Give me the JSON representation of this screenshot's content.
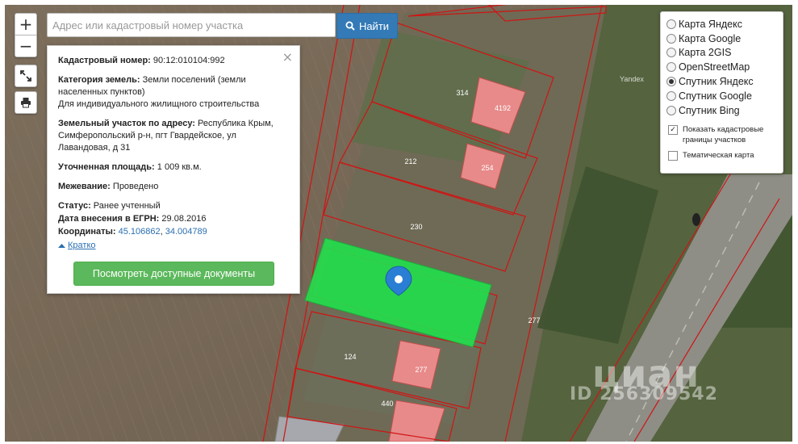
{
  "search": {
    "placeholder": "Адрес или кадастровый номер участка",
    "button_label": "Найти"
  },
  "zoom": {
    "in_label": "+",
    "out_label": "−"
  },
  "popup": {
    "cadastral_label": "Кадастровый номер:",
    "cadastral_value": "90:12:010104:992",
    "category_label": "Категория земель:",
    "category_value": "Земли поселений (земли населенных пунктов)",
    "category_use": "Для индивидуального жилищного строительства",
    "address_label": "Земельный участок по адресу:",
    "address_value": "Республика Крым, Симферопольский р-н, пгт Гвардейское, ул Лавандовая, д 31",
    "area_label": "Уточненная площадь:",
    "area_value": "1 009 кв.м.",
    "survey_label": "Межевание:",
    "survey_value": "Проведено",
    "status_label": "Статус:",
    "status_value": "Ранее учтенный",
    "egrn_label": "Дата внесения в ЕГРН:",
    "egrn_value": "29.08.2016",
    "coords_label": "Координаты:",
    "coords_lat": "45.106862",
    "coords_sep": ", ",
    "coords_lon": "34.004789",
    "brief_label": "Кратко",
    "docs_button": "Посмотреть доступные документы",
    "close_label": "×"
  },
  "layers": {
    "options": [
      "Карта Яндекс",
      "Карта Google",
      "Карта 2GIS",
      "OpenStreetMap",
      "Спутник Яндекс",
      "Спутник Google",
      "Спутник Bing"
    ],
    "selected": "Спутник Яндекс",
    "show_cadastral": "Показать кадастровые границы участков",
    "show_cadastral_checked": true,
    "thematic": "Тематическая карта",
    "thematic_checked": false
  },
  "map": {
    "parcel_labels": [
      "314",
      "4192",
      "212",
      "254",
      "230",
      "277",
      "124",
      "277",
      "440"
    ],
    "selected_parcel_color": "#22e04d",
    "boundary_color": "#d01414",
    "building_color": "#e88a8a",
    "attribution": "Yandex",
    "watermark": "циан",
    "watermark_id": "ID 256309542"
  }
}
